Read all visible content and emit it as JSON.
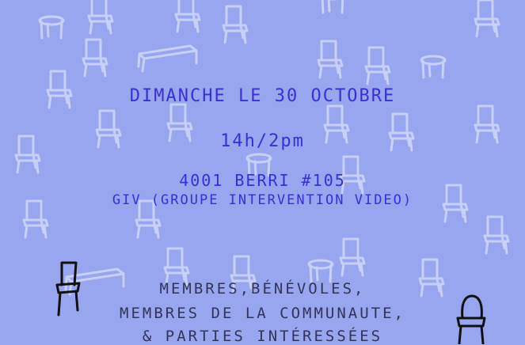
{
  "event": {
    "date": "DIMANCHE LE 30 OCTOBRE",
    "time": "14h/2pm",
    "address": "4001 BERRI #105",
    "organization": "GIV (GROUPE INTERVENTION VIDEO)"
  },
  "audience": {
    "line1": "MEMBRES,BÉNÉVOLES,",
    "line2": "MEMBRES DE LA COMMUNAUTE,",
    "line3": "& PARTIES INTÉRESSÉES"
  },
  "colors": {
    "background": "#97a6ef",
    "chair_sketch": "#c9d0f7",
    "accent_text": "#3a2fd6",
    "dark_text": "#33345a"
  },
  "icons": [
    "chair-icon",
    "table-icon",
    "stool-icon"
  ]
}
